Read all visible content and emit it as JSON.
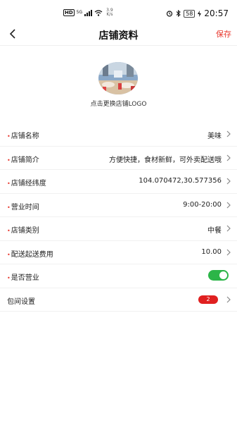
{
  "status_bar": {
    "hd": "HD",
    "signal_type": "5G",
    "speed_value": "3.9",
    "speed_unit": "K/s",
    "battery": "58",
    "time": "20:57"
  },
  "header": {
    "title": "店铺资料",
    "save_label": "保存"
  },
  "logo": {
    "caption": "点击更换店铺LOGO"
  },
  "rows": [
    {
      "label": "店铺名称",
      "required": "•",
      "value": "美味"
    },
    {
      "label": "店铺简介",
      "required": "•",
      "value": "方便快捷，食材新鲜，可外卖配送哦"
    },
    {
      "label": "店铺经纬度",
      "required": "•",
      "value": "104.070472,30.577356"
    },
    {
      "label": "营业时间",
      "required": "•",
      "value": "9:00-20:00"
    },
    {
      "label": "店铺类别",
      "required": "•",
      "value": "中餐"
    },
    {
      "label": "配送起送费用",
      "required": "•",
      "value": "10.00"
    },
    {
      "label": "是否营业",
      "required": "•",
      "toggle_on": true
    },
    {
      "label": "包间设置",
      "badge": "2"
    }
  ],
  "colors": {
    "accent": "#e8382e",
    "toggle_on": "#2cb548",
    "badge": "#e02020"
  }
}
